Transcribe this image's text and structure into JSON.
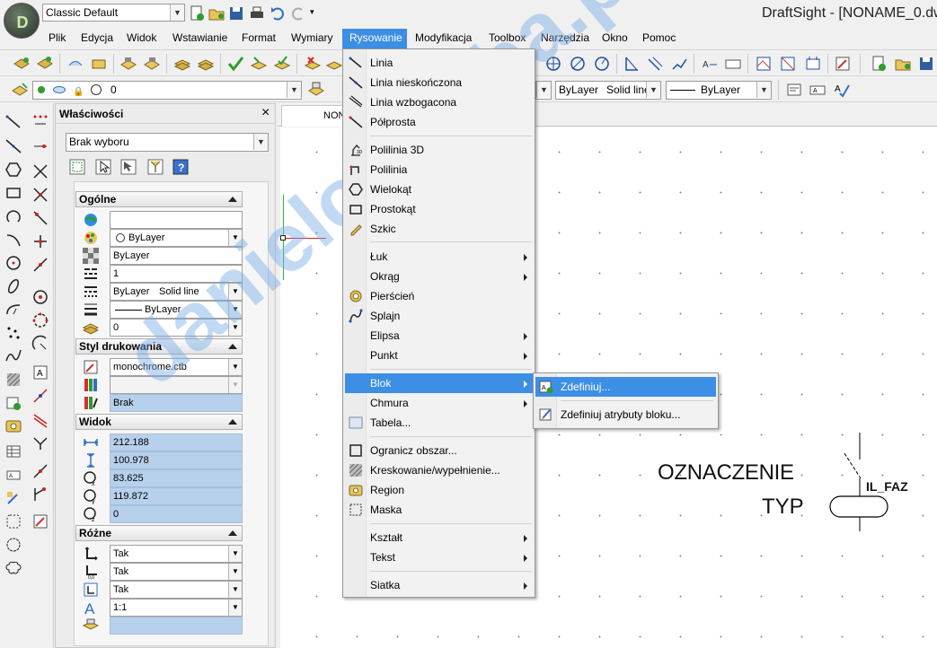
{
  "app": {
    "title": "DraftSight - [NONAME_0.dw",
    "workspace": "Classic Default"
  },
  "menubar": [
    "Plik",
    "Edycja",
    "Widok",
    "Wstawianie",
    "Format",
    "Wymiary",
    "Rysowanie",
    "Modyfikacja",
    "Toolbox",
    "Narzędzia",
    "Okno",
    "Pomoc"
  ],
  "layer_toolbar": {
    "layer_value": "0",
    "color_value": "ByLayer",
    "linestyle_value": "Solid line",
    "lineweight_value": "ByLayer"
  },
  "properties": {
    "title": "Właściwości",
    "close": "×",
    "selection": "Brak wyboru",
    "sections": {
      "general": "Ogólne",
      "print_style": "Styl drukowania",
      "view": "Widok",
      "misc": "Różne"
    },
    "general_rows": [
      "",
      "ByLayer",
      "ByLayer",
      "1",
      "ByLayer",
      "Solid line",
      "ByLayer",
      "0"
    ],
    "print_rows": [
      "monochrome.ctb",
      "",
      "Brak"
    ],
    "view_rows": [
      "212.188",
      "100.978",
      "83.625",
      "119.872",
      "0"
    ],
    "misc_rows": [
      "Tak",
      "Tak",
      "Tak",
      "1:1",
      ""
    ]
  },
  "drawing": {
    "tab": "NON",
    "label1": "OZNACZENIE",
    "label2": "TYP",
    "tag": "IL_FAZ"
  },
  "rysowanie_menu": [
    {
      "label": "Linia",
      "icon": "line-icon"
    },
    {
      "label": "Linia nieskończona",
      "icon": "infinite-line-icon"
    },
    {
      "label": "Linia wzbogacona",
      "icon": "rich-line-icon"
    },
    {
      "label": "Półprosta",
      "icon": "ray-icon"
    },
    {
      "label": "Polilinia 3D",
      "icon": "polyline-3d-icon"
    },
    {
      "label": "Polilinia",
      "icon": "polyline-icon"
    },
    {
      "label": "Wielokąt",
      "icon": "polygon-icon"
    },
    {
      "label": "Prostokąt",
      "icon": "rectangle-icon"
    },
    {
      "label": "Szkic",
      "icon": "sketch-icon"
    },
    {
      "label": "Łuk",
      "icon": "",
      "sub": true
    },
    {
      "label": "Okrąg",
      "icon": "",
      "sub": true
    },
    {
      "label": "Pierścień",
      "icon": "ring-icon"
    },
    {
      "label": "Splajn",
      "icon": "spline-icon"
    },
    {
      "label": "Elipsa",
      "icon": "",
      "sub": true
    },
    {
      "label": "Punkt",
      "icon": "",
      "sub": true
    },
    {
      "label": "Blok",
      "icon": "",
      "sub": true
    },
    {
      "label": "Chmura",
      "icon": "",
      "sub": true
    },
    {
      "label": "Tabela...",
      "icon": "table-icon"
    },
    {
      "label": "Ogranicz obszar...",
      "icon": "boundary-icon"
    },
    {
      "label": "Kreskowanie/wypełnienie...",
      "icon": "hatch-icon"
    },
    {
      "label": "Region",
      "icon": "region-icon"
    },
    {
      "label": "Maska",
      "icon": "mask-icon"
    },
    {
      "label": "Kształt",
      "icon": "",
      "sub": true
    },
    {
      "label": "Tekst",
      "icon": "",
      "sub": true
    },
    {
      "label": "Siatka",
      "icon": "",
      "sub": true
    }
  ],
  "blok_submenu": [
    "Zdefiniuj...",
    "Zdefiniuj atrybuty bloku..."
  ],
  "watermark": "danielo88.cba.pl",
  "colors": {
    "menu_highlight": "#3d8ee5",
    "drawing_bg": "#ffffff",
    "blue_field": "#b7d0ec"
  }
}
